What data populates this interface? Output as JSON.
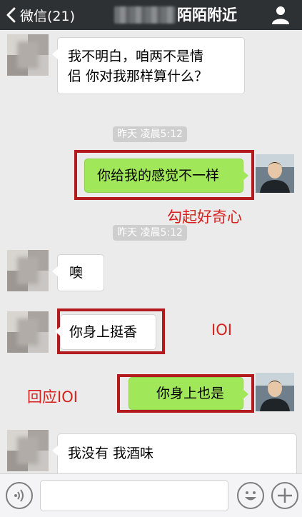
{
  "header": {
    "back_label": "微信(21)",
    "title": "陌陌附近"
  },
  "messages": {
    "m1": "我不明白，咱两不是情侣 你对我那样算什么？",
    "m1_line1": "我不明白，咱两不是情",
    "m1_line2": "侣 你对我那样算什么？",
    "ts1": "昨天 凌晨5:12",
    "m2": "你给我的感觉不一样",
    "ts2": "昨天 凌晨5:12",
    "m3": "噢",
    "m4": "你身上挺香",
    "m5": "你身上也是",
    "m6": "我没有  我酒味"
  },
  "annotations": {
    "a1": "勾起好奇心",
    "a2": "IOI",
    "a3": "回应IOI"
  },
  "colors": {
    "topbar": "#2e3133",
    "background": "#ebebeb",
    "green_bubble": "#a0e759",
    "annotation_red": "#d6221f"
  },
  "icons": [
    "chevron-left-icon",
    "person-icon",
    "voice-icon",
    "emoji-icon",
    "plus-icon"
  ]
}
